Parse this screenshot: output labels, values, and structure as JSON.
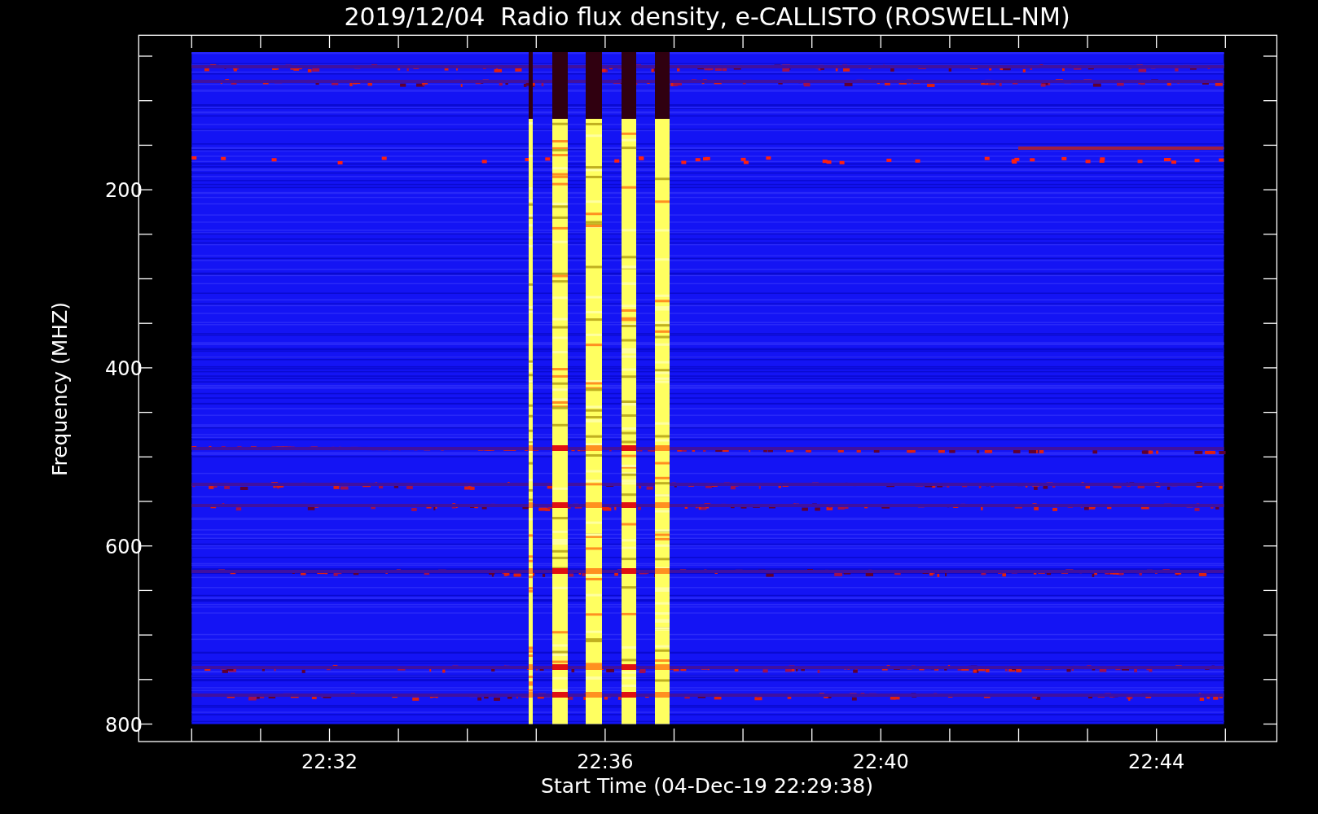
{
  "title": "2019/12/04  Radio flux density, e-CALLISTO (ROSWELL-NM)",
  "y_axis": {
    "label": "Frequency (MHZ)",
    "tick_labels": [
      "200",
      "400",
      "600",
      "800"
    ]
  },
  "x_axis": {
    "label": "Start Time (04-Dec-19 22:29:38)",
    "tick_labels": [
      "22:32",
      "22:36",
      "22:40",
      "22:44"
    ]
  }
}
